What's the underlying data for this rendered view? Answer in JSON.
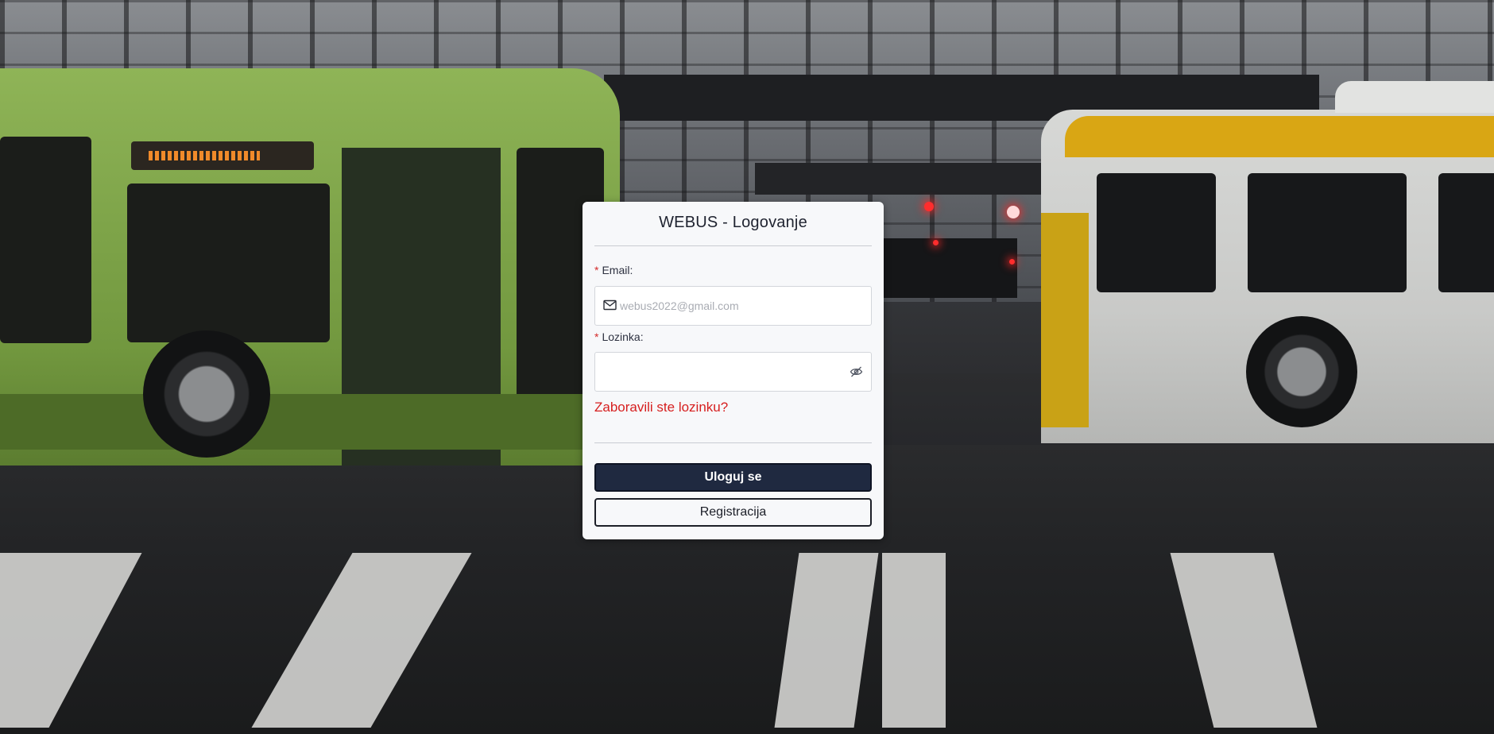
{
  "login": {
    "title": "WEBUS - Logovanje",
    "email": {
      "required_mark": "*",
      "label": "Email:",
      "placeholder": "webus2022@gmail.com",
      "value": "",
      "icon": "envelope-icon"
    },
    "password": {
      "required_mark": "*",
      "label": "Lozinka:",
      "value": "",
      "icon": "eye-hidden-icon"
    },
    "forgot_link": "Zaboravili ste lozinku?",
    "login_button": "Uloguj se",
    "register_button": "Registracija"
  },
  "colors": {
    "primary_button": "#1f2940",
    "link_red": "#d61f1f",
    "required_red": "#d42a2a",
    "card_bg": "#f7f8fa"
  }
}
